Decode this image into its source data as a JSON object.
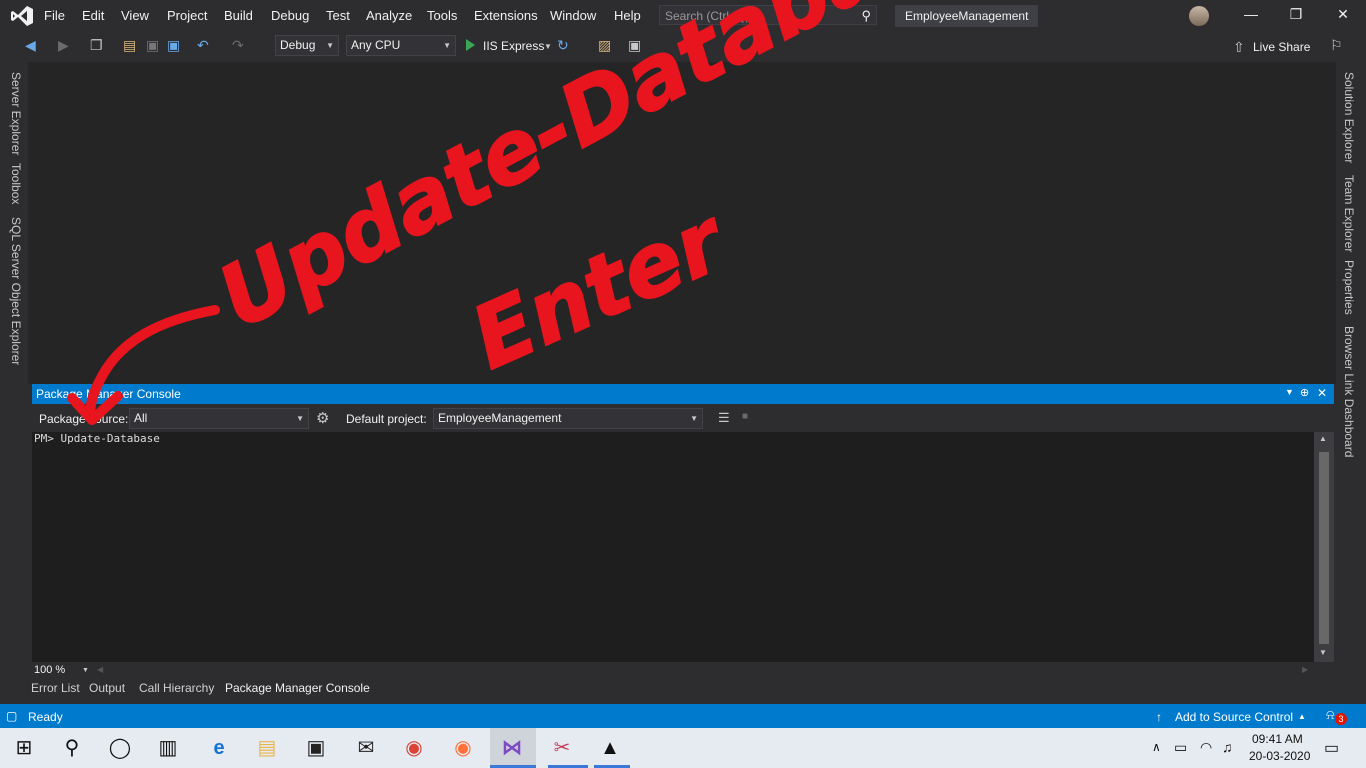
{
  "menu": [
    "File",
    "Edit",
    "View",
    "Project",
    "Build",
    "Debug",
    "Test",
    "Analyze",
    "Tools",
    "Extensions",
    "Window",
    "Help"
  ],
  "search": {
    "placeholder": "Search (Ctrl+Q)"
  },
  "solution_name": "EmployeeManagement",
  "toolbar": {
    "config": "Debug",
    "platform": "Any CPU",
    "run_target": "IIS Express",
    "live_share": "Live Share"
  },
  "left_rail": [
    "Server Explorer",
    "Toolbox",
    "SQL Server Object Explorer"
  ],
  "right_rail": [
    "Solution Explorer",
    "Team Explorer",
    "Properties",
    "Browser Link Dashboard"
  ],
  "console": {
    "title": "Package Manager Console",
    "package_source_label": "Package source:",
    "package_source_value": "All",
    "default_project_label": "Default project:",
    "default_project_value": "EmployeeManagement",
    "prompt_line": "PM> Update-Database",
    "zoom": "100 %"
  },
  "bottom_tabs": [
    "Error List",
    "Output",
    "Call Hierarchy",
    "Package Manager Console"
  ],
  "status": {
    "ready": "Ready",
    "source_control": "Add to Source Control"
  },
  "annotation": {
    "line1": "Update-Database",
    "line2": "Enter"
  },
  "clock": {
    "time": "09:41 AM",
    "date": "20-03-2020"
  },
  "notification_count": "3",
  "colors": {
    "accent": "#007acc",
    "ink": "#e8141e"
  }
}
